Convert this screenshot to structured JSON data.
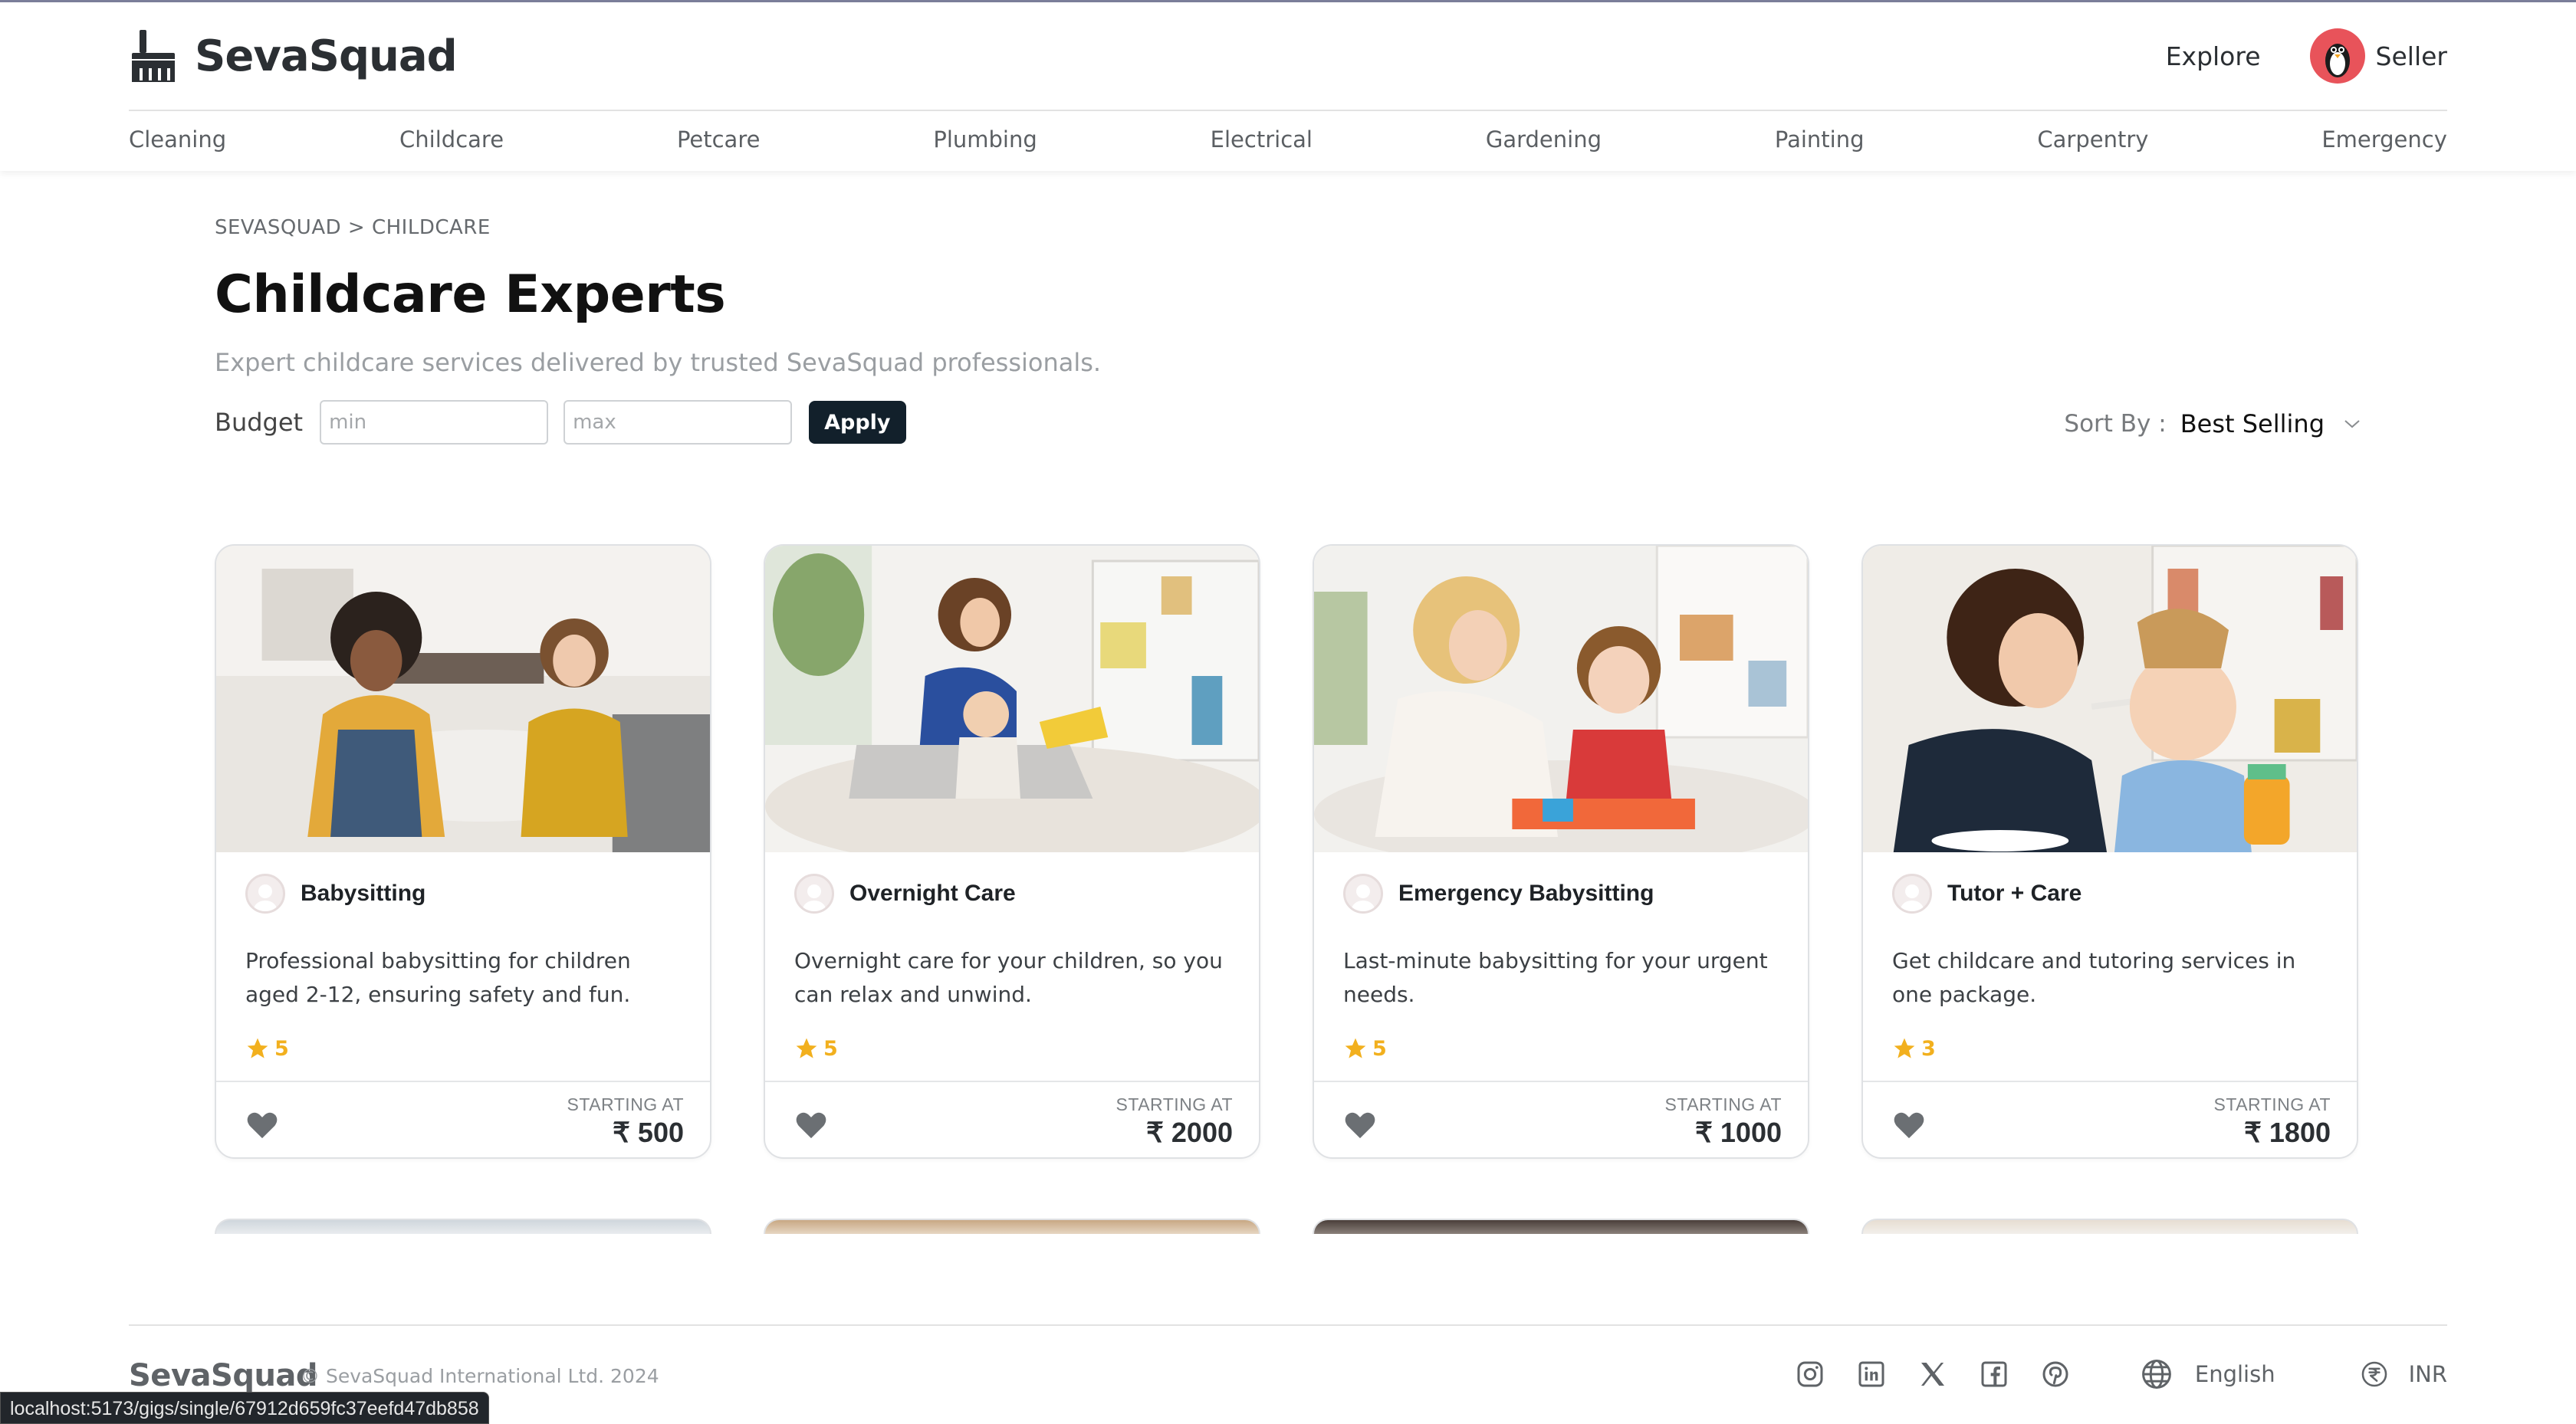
{
  "brand": {
    "name": "SevaSquad"
  },
  "nav": {
    "explore": "Explore",
    "seller": "Seller"
  },
  "categories": [
    "Cleaning",
    "Childcare",
    "Petcare",
    "Plumbing",
    "Electrical",
    "Gardening",
    "Painting",
    "Carpentry",
    "Emergency"
  ],
  "main": {
    "breadcrumb": "SEVASQUAD > CHILDCARE",
    "title": "Childcare Experts",
    "description": "Expert childcare services delivered by trusted SevaSquad professionals.",
    "budget_label": "Budget",
    "min_placeholder": "min",
    "max_placeholder": "max",
    "apply_label": "Apply",
    "sort_label": "Sort By :",
    "sort_value": "Best Selling"
  },
  "cards": [
    {
      "seller": "Babysitting",
      "description": "Professional babysitting for children aged 2-12, ensuring safety and fun.",
      "rating": "5",
      "starting_label": "STARTING AT",
      "price": "₹ 500"
    },
    {
      "seller": "Overnight Care",
      "description": "Overnight care for your children, so you can relax and unwind.",
      "rating": "5",
      "starting_label": "STARTING AT",
      "price": "₹ 2000"
    },
    {
      "seller": "Emergency Babysitting",
      "description": "Last-minute babysitting for your urgent needs.",
      "rating": "5",
      "starting_label": "STARTING AT",
      "price": "₹ 1000"
    },
    {
      "seller": "Tutor + Care",
      "description": "Get childcare and tutoring services in one package.",
      "rating": "3",
      "starting_label": "STARTING AT",
      "price": "₹ 1800"
    }
  ],
  "footer": {
    "brand": "SevaSquad",
    "copyright": "© SevaSquad International Ltd. 2024",
    "social_icons": [
      "instagram-icon",
      "linkedin-icon",
      "x-icon",
      "facebook-icon",
      "pinterest-icon"
    ],
    "language": "English",
    "currency": "INR"
  },
  "status_bar": {
    "url": "localhost:5173/gigs/single/67912d659fc37eefd47db858"
  },
  "colors": {
    "star": "#f2b01e",
    "apply_bg": "#12202b",
    "text_dark": "#111111"
  }
}
